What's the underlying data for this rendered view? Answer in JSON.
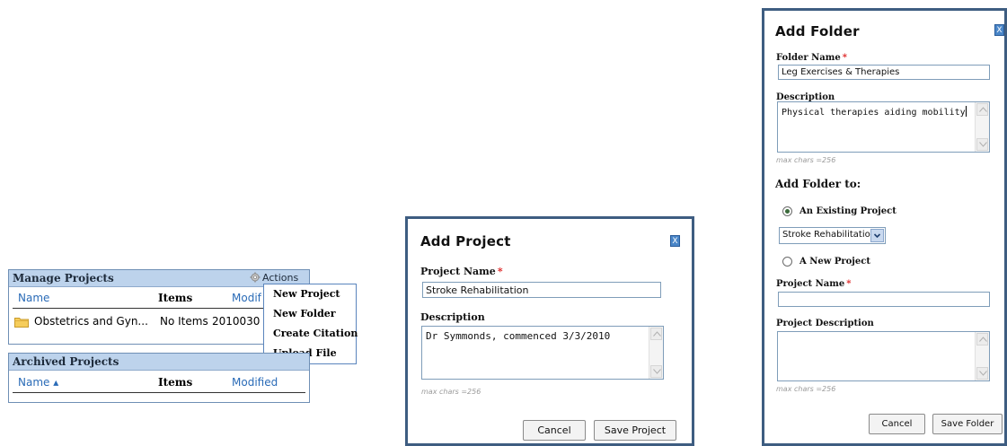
{
  "manage_panel": {
    "title": "Manage Projects",
    "actions_label": "Actions",
    "columns": {
      "name": "Name",
      "items": "Items",
      "modified": "Modif"
    },
    "rows": [
      {
        "name": "Obstetrics and Gyn...",
        "items": "No Items",
        "modified": "2010030"
      }
    ]
  },
  "actions_menu": {
    "items": [
      "New Project",
      "New Folder",
      "Create Citation",
      "Upload File"
    ]
  },
  "archived_panel": {
    "title": "Archived Projects",
    "columns": {
      "name": "Name ▴",
      "items": "Items",
      "modified": "Modified"
    }
  },
  "add_project_dialog": {
    "title": "Add Project",
    "close": "X",
    "project_name_label": "Project Name",
    "required_mark": "*",
    "project_name_value": "Stroke Rehabilitation",
    "description_label": "Description",
    "description_value": "Dr Symmonds, commenced 3/3/2010",
    "max_chars_hint": "max chars =256",
    "cancel_label": "Cancel",
    "save_label": "Save Project"
  },
  "add_folder_dialog": {
    "title": "Add Folder",
    "close": "X",
    "folder_name_label": "Folder Name",
    "required_mark": "*",
    "folder_name_value": "Leg Exercises & Therapies",
    "description_label": "Description",
    "description_value": "Physical therapies aiding mobility",
    "max_chars_hint": "max chars =256",
    "add_to_label": "Add Folder to:",
    "existing_project_label": "An Existing Project",
    "existing_project_selected": "Stroke Rehabilitation",
    "new_project_label": "A New Project",
    "project_name_label": "Project Name",
    "project_name_value": "",
    "project_description_label": "Project Description",
    "project_description_value": "",
    "max_chars_hint_2": "max chars =256",
    "cancel_label": "Cancel",
    "save_label": "Save Folder"
  },
  "colors": {
    "panel_header": "#bdd3ec",
    "link": "#2a6bb7",
    "dialog_border": "#3e5d81",
    "required": "#dd2222",
    "close_button": "#4a86c8"
  }
}
